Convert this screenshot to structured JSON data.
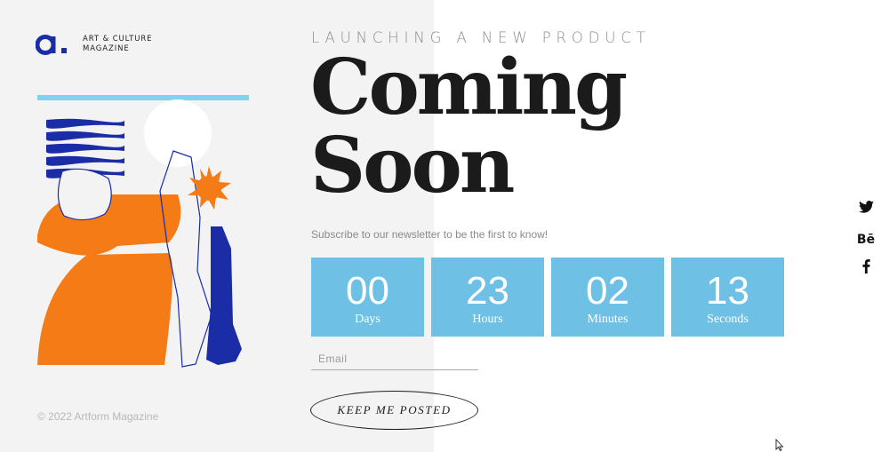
{
  "brand": {
    "logo_letter": "a.",
    "tagline_line1": "ART & CULTURE",
    "tagline_line2": "MAGAZINE"
  },
  "hero": {
    "eyebrow": "LAUNCHING A NEW PRODUCT",
    "title_line1": "Coming",
    "title_line2": "Soon",
    "subtitle": "Subscribe to our newsletter to be the first to know!"
  },
  "countdown": [
    {
      "value": "00",
      "label": "Days"
    },
    {
      "value": "23",
      "label": "Hours"
    },
    {
      "value": "02",
      "label": "Minutes"
    },
    {
      "value": "13",
      "label": "Seconds"
    }
  ],
  "form": {
    "email_placeholder": "Email",
    "email_value": "",
    "submit_label": "KEEP ME POSTED"
  },
  "footer": {
    "copyright": "© 2022 Artform Magazine"
  },
  "social": [
    {
      "icon": "twitter-icon"
    },
    {
      "icon": "behance-icon",
      "text": "Bē"
    },
    {
      "icon": "facebook-icon"
    }
  ],
  "colors": {
    "left_panel_bg": "#f3f3f3",
    "accent_blue": "#6ec0e4",
    "brand_navy": "#1a2ca6",
    "orange": "#f47b16",
    "light_blue_bar": "#7fd3ea"
  }
}
